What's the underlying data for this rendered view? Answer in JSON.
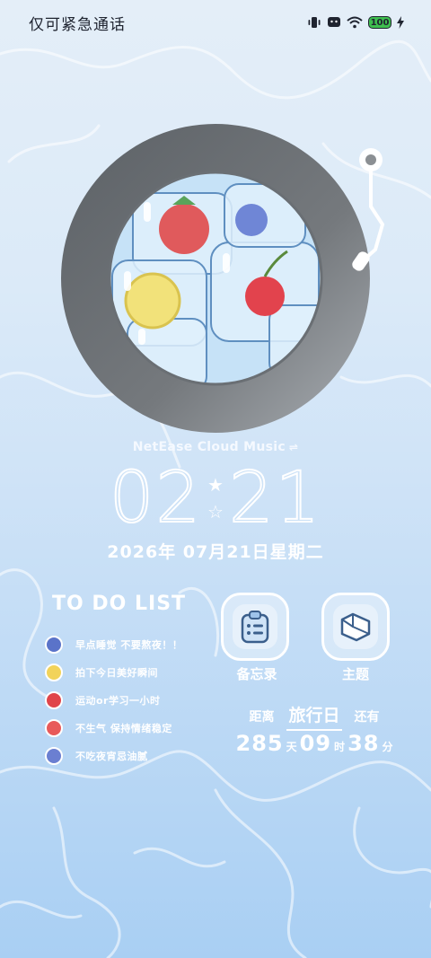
{
  "status_bar": {
    "carrier_text": "仅可紧急通话",
    "battery_level": "100",
    "icons": [
      "vibrate-icon",
      "notification-icon",
      "wifi-icon",
      "battery-icon",
      "charging-icon"
    ]
  },
  "music_widget": {
    "source_label": "NetEase Cloud Music",
    "switch_symbol": "⇌"
  },
  "clock": {
    "hours": "02",
    "minutes": "21",
    "date_line": "2026年 07月21日星期二"
  },
  "todo": {
    "title": "TO DO LIST",
    "items": [
      {
        "text": "早点睡觉 不要熬夜！！",
        "color": "#5a73c9"
      },
      {
        "text": "拍下今日美好瞬间",
        "color": "#f2d35a"
      },
      {
        "text": "运动or学习一小时",
        "color": "#e0454a"
      },
      {
        "text": "不生气 保持情绪稳定",
        "color": "#e85a5a"
      },
      {
        "text": "不吃夜宵忌油腻",
        "color": "#6b7fd1"
      }
    ]
  },
  "apps": {
    "memo_label": "备忘录",
    "theme_label": "主题"
  },
  "countdown": {
    "prefix": "距离",
    "event": "旅行日",
    "suffix": "还有",
    "days": "285",
    "days_unit": "天",
    "hours": "09",
    "hours_unit": "时",
    "minutes": "38",
    "minutes_unit": "分"
  },
  "colors": {
    "vinyl_ring": "#6e7378",
    "background_top": "#e4eef8",
    "background_bottom": "#a9cff3"
  }
}
